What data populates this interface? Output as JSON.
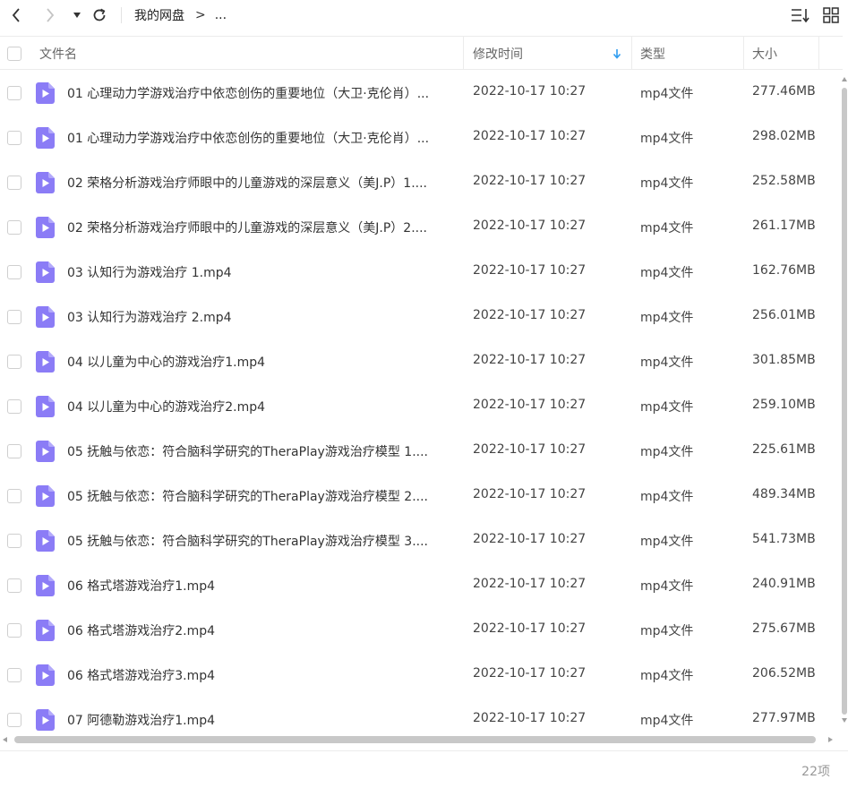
{
  "toolbar": {
    "back_icon": "chevron-left-icon",
    "forward_icon": "chevron-right-icon",
    "history_icon": "caret-down-icon",
    "refresh_icon": "refresh-icon",
    "sort_icon": "sort-list-icon",
    "grid_icon": "grid-view-icon"
  },
  "breadcrumb": {
    "root": "我的网盘",
    "separator": ">",
    "more": "..."
  },
  "columns": {
    "name": "文件名",
    "modified": "修改时间",
    "type": "类型",
    "size": "大小"
  },
  "files": [
    {
      "name": "01 心理动力学游戏治疗中依恋创伤的重要地位（大卫·克伦肖）...",
      "modified": "2022-10-17 10:27",
      "type": "mp4文件",
      "size": "277.46MB"
    },
    {
      "name": "01 心理动力学游戏治疗中依恋创伤的重要地位（大卫·克伦肖）...",
      "modified": "2022-10-17 10:27",
      "type": "mp4文件",
      "size": "298.02MB"
    },
    {
      "name": "02 荣格分析游戏治疗师眼中的儿童游戏的深层意义（美J.P）1....",
      "modified": "2022-10-17 10:27",
      "type": "mp4文件",
      "size": "252.58MB"
    },
    {
      "name": "02 荣格分析游戏治疗师眼中的儿童游戏的深层意义（美J.P）2....",
      "modified": "2022-10-17 10:27",
      "type": "mp4文件",
      "size": "261.17MB"
    },
    {
      "name": "03 认知行为游戏治疗 1.mp4",
      "modified": "2022-10-17 10:27",
      "type": "mp4文件",
      "size": "162.76MB"
    },
    {
      "name": "03 认知行为游戏治疗 2.mp4",
      "modified": "2022-10-17 10:27",
      "type": "mp4文件",
      "size": "256.01MB"
    },
    {
      "name": "04 以儿童为中心的游戏治疗1.mp4",
      "modified": "2022-10-17 10:27",
      "type": "mp4文件",
      "size": "301.85MB"
    },
    {
      "name": "04 以儿童为中心的游戏治疗2.mp4",
      "modified": "2022-10-17 10:27",
      "type": "mp4文件",
      "size": "259.10MB"
    },
    {
      "name": "05 抚触与依恋：符合脑科学研究的TheraPlay游戏治疗模型 1....",
      "modified": "2022-10-17 10:27",
      "type": "mp4文件",
      "size": "225.61MB"
    },
    {
      "name": "05 抚触与依恋：符合脑科学研究的TheraPlay游戏治疗模型 2....",
      "modified": "2022-10-17 10:27",
      "type": "mp4文件",
      "size": "489.34MB"
    },
    {
      "name": "05 抚触与依恋：符合脑科学研究的TheraPlay游戏治疗模型 3....",
      "modified": "2022-10-17 10:27",
      "type": "mp4文件",
      "size": "541.73MB"
    },
    {
      "name": "06 格式塔游戏治疗1.mp4",
      "modified": "2022-10-17 10:27",
      "type": "mp4文件",
      "size": "240.91MB"
    },
    {
      "name": "06 格式塔游戏治疗2.mp4",
      "modified": "2022-10-17 10:27",
      "type": "mp4文件",
      "size": "275.67MB"
    },
    {
      "name": "06 格式塔游戏治疗3.mp4",
      "modified": "2022-10-17 10:27",
      "type": "mp4文件",
      "size": "206.52MB"
    },
    {
      "name": "07 阿德勒游戏治疗1.mp4",
      "modified": "2022-10-17 10:27",
      "type": "mp4文件",
      "size": "277.97MB"
    }
  ],
  "footer": {
    "count": "22项"
  },
  "colors": {
    "file_icon": "#8b7cf6",
    "sort_arrow": "#2f9df0",
    "divider": "#ececec"
  }
}
